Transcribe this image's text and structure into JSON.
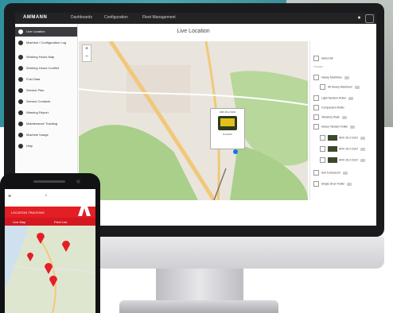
{
  "app": {
    "brand": "AMMANN",
    "nav": [
      "Dashboards",
      "Configuration",
      "Fleet Management"
    ],
    "page_title": "Live Location",
    "topbar_icons": [
      "bell-icon",
      "user-icon"
    ]
  },
  "sidebar": {
    "items": [
      {
        "label": "Live Location",
        "icon": "location-icon",
        "active": true
      },
      {
        "label": "Machine / Configuration Log",
        "icon": "log-icon"
      },
      {
        "label": "Working Hours Map",
        "icon": "clock-icon"
      },
      {
        "label": "Working Hours Conflict",
        "icon": "warning-icon"
      },
      {
        "label": "Fuel Data",
        "icon": "fuel-icon"
      },
      {
        "label": "Service Plan",
        "icon": "wrench-icon"
      },
      {
        "label": "Service Contacts",
        "icon": "contact-icon"
      },
      {
        "label": "Warning Report",
        "icon": "alert-icon"
      },
      {
        "label": "Maintenance Tracking",
        "icon": "tool-icon"
      },
      {
        "label": "Machine Usage",
        "icon": "chart-icon"
      },
      {
        "label": "Help",
        "icon": "help-icon"
      }
    ]
  },
  "map": {
    "zoom_in": "+",
    "zoom_out": "−",
    "popup": {
      "name": "ARX 26-2 DUO",
      "line": "0.0 km/h"
    }
  },
  "filters": {
    "select_all": "Select All",
    "group_label": "Groups",
    "rows": [
      "Heavy Machines",
      "All Heavy Machines",
      "Light Tandem Roller",
      "Compaction Roller",
      "Vibratory Plate",
      "Heavy Tandem Roller",
      "ARX 26-2 DUO",
      "ARX 26-2 DUO",
      "ARX 26-2 DUO",
      "Soil Compactor",
      "Single Drum Roller"
    ]
  },
  "phone": {
    "header_title": "LOCATION TRACKING",
    "tabs": [
      "Live Map",
      "Fleet List"
    ],
    "brand_icon": "ammann-logo"
  },
  "colors": {
    "accent_red": "#e31e24",
    "topbar": "#232326",
    "map_green": "#a9cf8a",
    "map_road": "#f1c87a"
  }
}
